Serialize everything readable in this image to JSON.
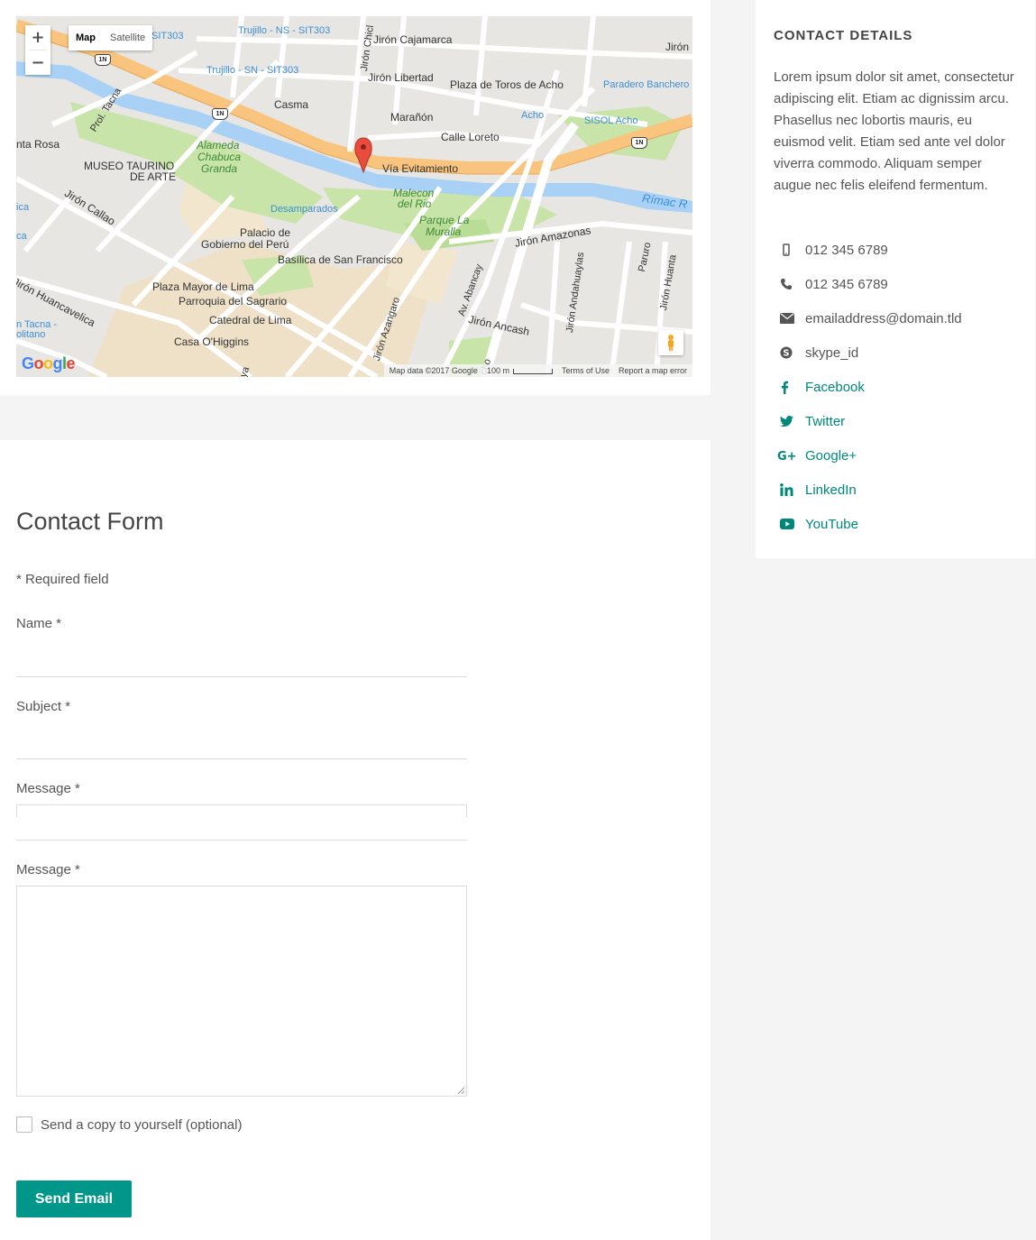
{
  "map": {
    "zoom_in": "+",
    "zoom_out": "−",
    "type_map": "Map",
    "type_satellite": "Satellite",
    "labels": {
      "jiron_cajamarca": "Jirón Cajamarca",
      "jiron_libertad": "Jirón Libertad",
      "plaza_toros": "Plaza de Toros de Acho",
      "paradero": "Paradero Banchero",
      "jiron_top_right": "Jirón",
      "casma": "Casma",
      "maranon": "Marañón",
      "acho": "Acho",
      "sisol": "SISOL Acho",
      "calle_loreto": "Calle Loreto",
      "via_evitamiento": "Vía Evitamiento",
      "rimac": "Rímac R",
      "trujillo_ns": "Trujillo - NS - SIT303",
      "trujillo_sn": "Trujillo - SN - SIT303",
      "sit303": "SIT303",
      "prol_tacna": "Prol. Tacna",
      "santa_rosa": "nta Rosa",
      "museo_line1": "MUSEO TAURINO",
      "museo_line2": "DE ARTE",
      "alameda_1": "Alameda",
      "alameda_2": "Chabuca",
      "alameda_3": "Granda",
      "malecon_1": "Malecon",
      "malecon_2": "del Rio",
      "desamparados": "Desamparados",
      "parque_1": "Parque La",
      "parque_2": "Muralla",
      "jiron_amazonas": "Jirón Amazonas",
      "jiron_callao": "Jirón Callao",
      "palacio_1": "Palacio de",
      "palacio_2": "Gobierno del Perú",
      "basilica": "Basílica de San Francisco",
      "plaza_mayor": "Plaza Mayor de Lima",
      "parroquia": "Parroquia del Sagrario",
      "catedral": "Catedral de Lima",
      "casa_ohiggins": "Casa O'Higgins",
      "jiron_huancavelica": "Jirón Huancavelica",
      "tacna_1": "n Tacna -",
      "tacna_2": "olitano",
      "jiron_ancash": "Jirón Ancash",
      "av_abancay": "Av. Abancay",
      "jiron_azangaro": "Jirón Azangaro",
      "jiron_andahuaylas": "Jirón Andahuaylas",
      "paruro": "Paruro",
      "jiron_huanta": "Jirón Huanta",
      "jiron_chiclayo": "Jirón Chicl",
      "ica_1": "ica",
      "ica_2": "ca",
      "cho": "cho",
      "ya": "ya",
      "shield_1n": "1N"
    },
    "attribution": {
      "map_data": "Map data ©2017 Google",
      "scale": "100 m",
      "terms": "Terms of Use",
      "report": "Report a map error"
    },
    "google_logo": {
      "G": "G",
      "o1": "o",
      "o2": "o",
      "g": "g",
      "l": "l",
      "e": "e"
    }
  },
  "form": {
    "title": "Contact Form",
    "required_note": "* Required field",
    "name_label": "Name *",
    "subject_label": "Subject *",
    "message_label_1": "Message *",
    "message_label_2": "Message *",
    "name_value": "",
    "subject_value": "",
    "message_value": "",
    "copy_label": "Send a copy to yourself (optional)",
    "send_label": "Send Email"
  },
  "sidebar": {
    "title": "CONTACT DETAILS",
    "description": "Lorem ipsum dolor sit amet, consectetur adipiscing elit. Etiam ac dignissim arcu. Phasellus nec lobortis mauris, eu euismod velit. Etiam sed ante vel dolor viverra commodo. Aliquam semper augue nec felis eleifend fermentum.",
    "items": [
      {
        "icon": "mobile-icon",
        "label": "012 345 6789"
      },
      {
        "icon": "phone-icon",
        "label": "012 345 6789"
      },
      {
        "icon": "envelope-icon",
        "label": "emailaddress@domain.tld"
      },
      {
        "icon": "skype-icon",
        "label": "skype_id"
      },
      {
        "icon": "facebook-icon",
        "label": "Facebook"
      },
      {
        "icon": "twitter-icon",
        "label": "Twitter"
      },
      {
        "icon": "google-plus-icon",
        "label": "Google+"
      },
      {
        "icon": "linkedin-icon",
        "label": "LinkedIn"
      },
      {
        "icon": "youtube-icon",
        "label": "YouTube"
      }
    ]
  },
  "colors": {
    "accent": "#00968a",
    "link": "#00877b",
    "page_bg": "#f4f4f4",
    "highway": "#f8c47e",
    "river": "#a9d1f5",
    "park": "#c8e4a9"
  }
}
